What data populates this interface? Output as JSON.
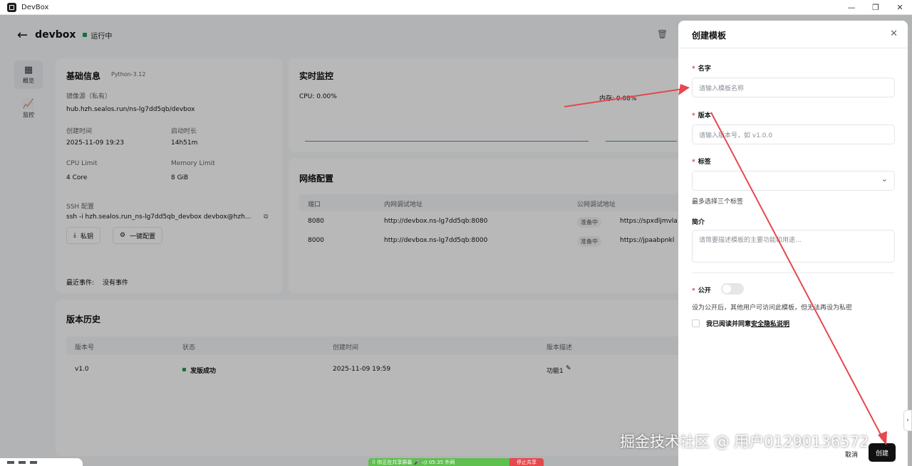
{
  "window": {
    "title": "DevBox",
    "controls": [
      "—",
      "❐",
      "✕"
    ]
  },
  "header": {
    "back_icon": "←",
    "name": "devbox",
    "status": "运行中",
    "status_color": "#1f9d55",
    "trash_icon": "🗑"
  },
  "nav": [
    {
      "icon": "▦",
      "label": "概览"
    },
    {
      "icon": "📈",
      "label": "监控"
    }
  ],
  "basic": {
    "title": "基础信息",
    "runtime": "Python-3.12",
    "image_label": "镜像源（私有）",
    "image_value": "hub.hzh.sealos.run/ns-lg7dd5qb/devbox",
    "created_label": "创建时间",
    "created_value": "2025-11-09 19:23",
    "uptime_label": "启动时长",
    "uptime_value": "14h51m",
    "cpu_label": "CPU Limit",
    "cpu_value": "4 Core",
    "mem_label": "Memory Limit",
    "mem_value": "8 GiB",
    "ssh_label": "SSH 配置",
    "ssh_value": "ssh -i hzh.sealos.run_ns-lg7dd5qb_devbox devbox@hzh...",
    "private_key_btn": "私钥",
    "one_click_btn": "一键配置",
    "events_label": "最近事件:",
    "events_value": "没有事件"
  },
  "monitor": {
    "title": "实时监控",
    "cpu": "CPU: 0.00%",
    "mem": "内存: 0.08%"
  },
  "network": {
    "title": "网络配置",
    "columns": [
      "端口",
      "内网调试地址",
      "公网调试地址"
    ],
    "rows": [
      {
        "port": "8080",
        "internal": "http://devbox.ns-lg7dd5qb:8080",
        "state": "准备中",
        "public": "https://spxdljmvla"
      },
      {
        "port": "8000",
        "internal": "http://devbox.ns-lg7dd5qb:8000",
        "state": "准备中",
        "public": "https://jpaabpnkl"
      }
    ]
  },
  "history": {
    "title": "版本历史",
    "columns": [
      "版本号",
      "状态",
      "创建时间",
      "版本描述"
    ],
    "rows": [
      {
        "version": "v1.0",
        "status": "发版成功",
        "created": "2025-11-09 19:59",
        "desc": "功能1"
      }
    ],
    "edit_icon": "✎"
  },
  "drawer": {
    "title": "创建模板",
    "close_icon": "✕",
    "name_label": "名字",
    "name_placeholder": "请输入模板名称",
    "version_label": "版本",
    "version_placeholder": "请输入版本号，如 v1.0.0",
    "tags_label": "标签",
    "tags_hint": "最多选择三个标签",
    "tags_chevron": "⌄",
    "intro_label": "简介",
    "intro_placeholder": "请简要描述模板的主要功能和用途...",
    "public_label": "公开",
    "public_hint": "设为公开后，其他用户可访问此模板，但无法再设为私密",
    "agree_prefix": "我已阅读并同意",
    "agree_link": "安全隐私说明",
    "cancel_btn": "取消",
    "create_btn": "创建"
  },
  "share_bar": {
    "text": "⠿ 你正在共享屏幕   🎤  ◁)  05:35  外网",
    "stop": "停止共享"
  },
  "watermark": "掘金技术社区 @ 用户01290136572",
  "colors": {
    "accent": "#111111",
    "required": "#e5484d",
    "annotation": "#e5484d"
  }
}
